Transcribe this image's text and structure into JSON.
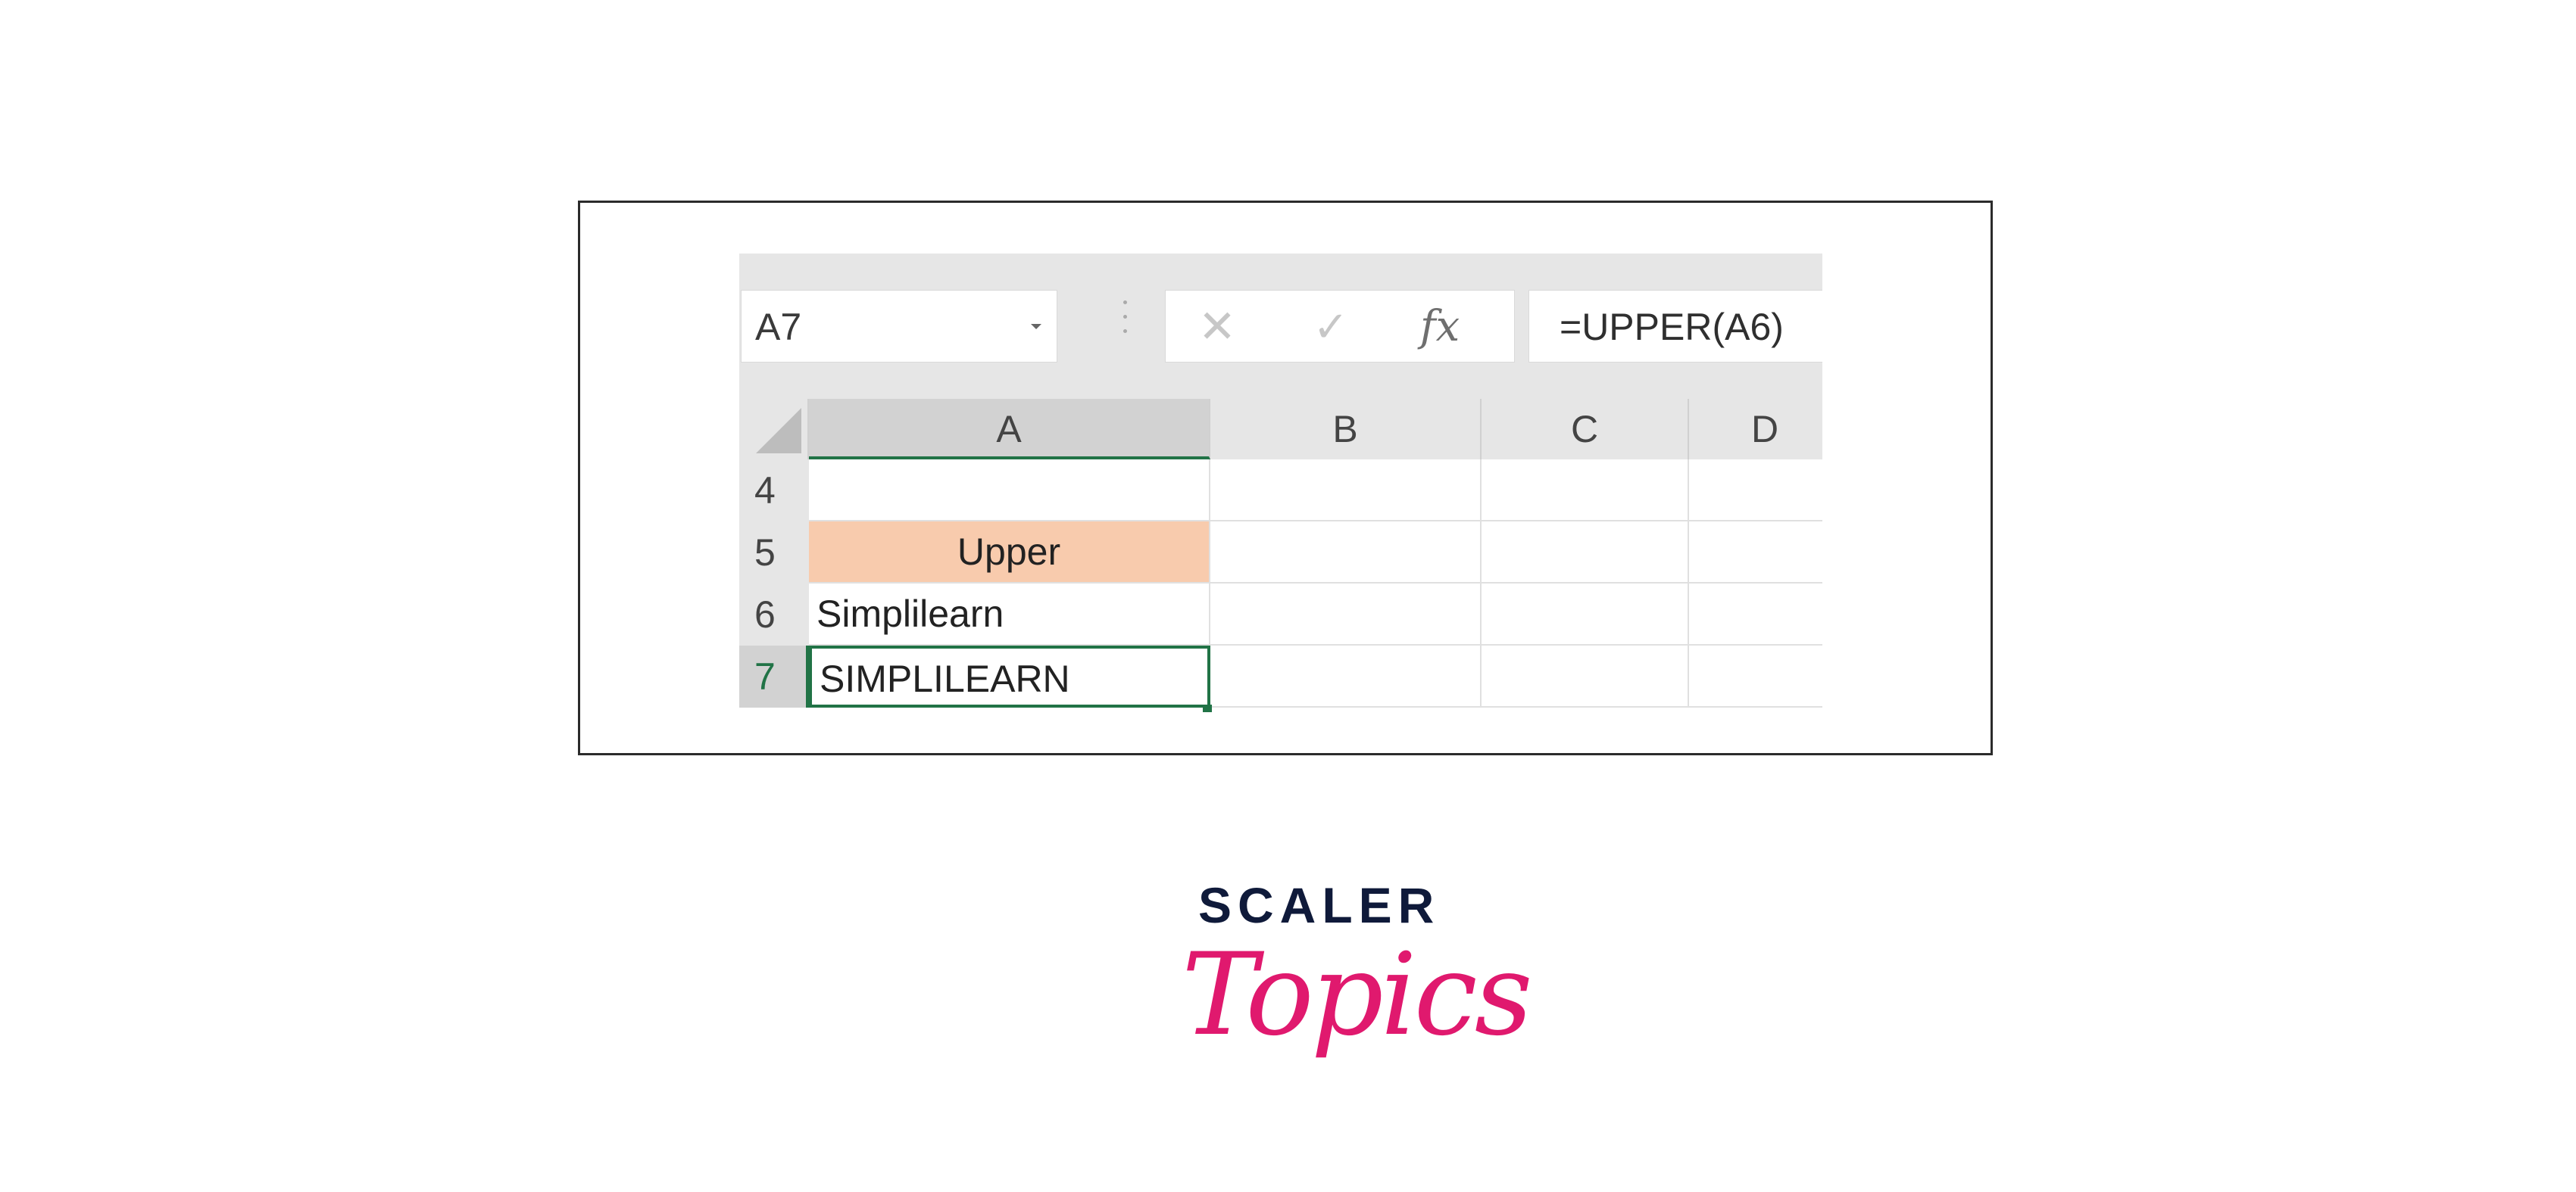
{
  "formula_bar": {
    "name_box": "A7",
    "cancel_icon": "✕",
    "enter_icon": "✓",
    "fx_label": "fx",
    "formula": "=UPPER(A6)"
  },
  "columns": [
    "A",
    "B",
    "C",
    "D"
  ],
  "rows": [
    {
      "number": "4",
      "a": "",
      "b": "",
      "c": "",
      "d": ""
    },
    {
      "number": "5",
      "a": "Upper",
      "b": "",
      "c": "",
      "d": ""
    },
    {
      "number": "6",
      "a": "Simplilearn",
      "b": "",
      "c": "",
      "d": ""
    },
    {
      "number": "7",
      "a": "SIMPLILEARN",
      "b": "",
      "c": "",
      "d": ""
    }
  ],
  "colors": {
    "header_fill": "#f8cbad",
    "selection": "#217346"
  },
  "logo": {
    "line1": "SCALER",
    "line2": "Topics"
  }
}
